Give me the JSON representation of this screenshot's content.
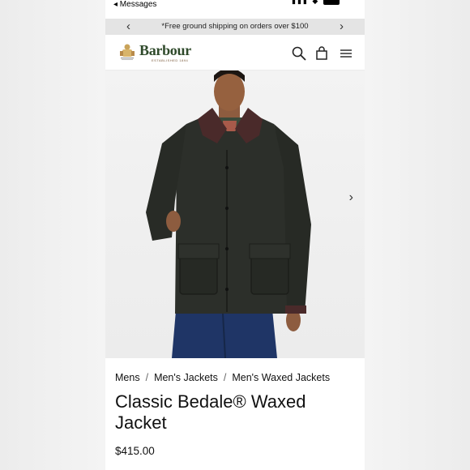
{
  "status_bar": {
    "back_label": "◂ Messages"
  },
  "promo": {
    "text": "*Free ground shipping on orders over $100",
    "prev": "‹",
    "next": "›"
  },
  "header": {
    "brand": "Barbour",
    "brand_sub": "ESTABLISHED 1894",
    "icons": [
      "search-icon",
      "shopping-bag-icon",
      "menu-icon"
    ]
  },
  "hero": {
    "next_arrow": "›"
  },
  "breadcrumb": [
    "Mens",
    "Men's Jackets",
    "Men's Waxed Jackets"
  ],
  "product": {
    "title": "Classic Bedale® Waxed Jacket",
    "price": "$415.00"
  },
  "colors": {
    "brand_green": "#2f4a2b",
    "promo_bg": "#e4e4e4",
    "jacket": "#2c2f2a",
    "collar": "#4a2a2a"
  }
}
